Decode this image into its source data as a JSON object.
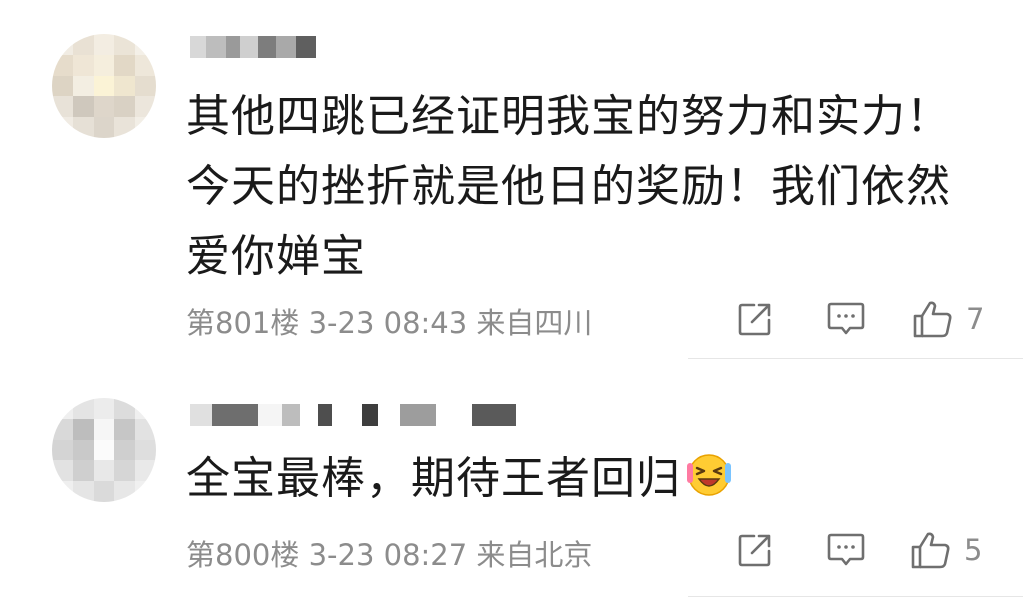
{
  "comments": [
    {
      "text": "其他四跳已经证明我宝的努力和实力！今天的挫折就是他日的奖励！我们依然爱你婵宝",
      "floor": "第801楼",
      "time": "3-23 08:43",
      "location": "来自四川",
      "like_count": "7",
      "icons": {
        "share": "share-icon",
        "reply": "comment-icon",
        "like": "thumbs-up-icon"
      }
    },
    {
      "text": "全宝最棒，期待王者回归",
      "emoji": "laughing-emoji",
      "floor": "第800楼",
      "time": "3-23 08:27",
      "location": "来自北京",
      "like_count": "5",
      "icons": {
        "share": "share-icon",
        "reply": "comment-icon",
        "like": "thumbs-up-icon"
      }
    }
  ]
}
